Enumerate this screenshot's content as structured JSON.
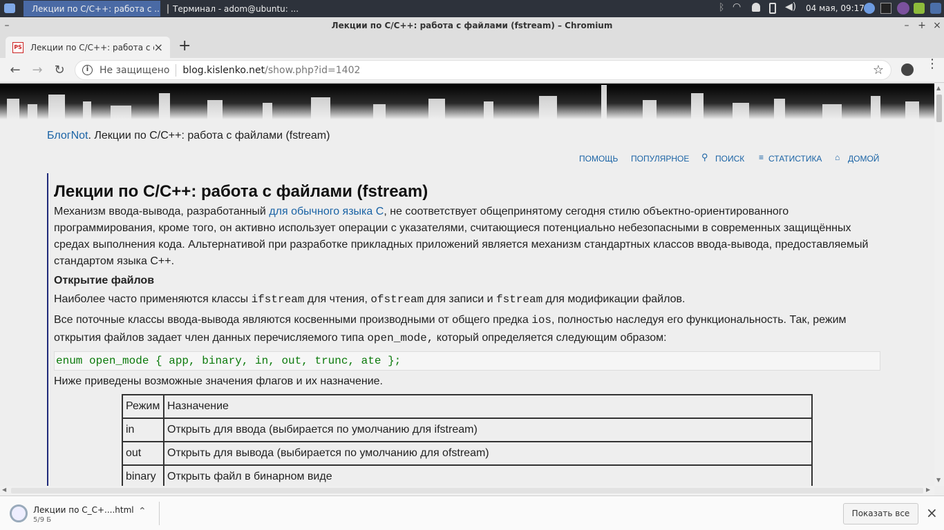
{
  "taskbar": {
    "tasks": [
      {
        "label": "Лекции по C/C++: работа с ..."
      },
      {
        "label": "Терминал - adom@ubuntu: ..."
      }
    ],
    "clock": "04 мая, 09:17"
  },
  "window": {
    "title": "Лекции по C/C++: работа с файлами (fstream) – Chromium"
  },
  "tab": {
    "title": "Лекции по C/C++: работа с фа",
    "favicon_text": "PS"
  },
  "omnibox": {
    "security": "Не защищено",
    "domain": "blog.kislenko.net",
    "path": "/show.php?id=1402"
  },
  "page": {
    "breadcrumb": {
      "link": "БлогNot",
      "rest": ". Лекции по C/C++: работа с файлами (fstream)"
    },
    "nav": {
      "help": "ПОМОЩЬ",
      "popular": "ПОПУЛЯРНОЕ",
      "search": "ПОИСК",
      "stats": "СТАТИСТИКА",
      "home": "ДОМОЙ"
    },
    "article": {
      "title": "Лекции по C/C++: работа с файлами (fstream)",
      "p1_a": "Механизм ввода-вывода, разработанный ",
      "p1_link": "для обычного языка С",
      "p1_b": ", не соответствует общепринятому сегодня стилю объектно-ориентированного программирования, кроме того, он активно использует операции с указателями, считающиеся потенциально небезопасными в современных защищённых средах выполнения кода. Альтернативой при разработке прикладных приложений является механизм стандартных классов ввода-вывода, предоставляемый стандартом языка C++.",
      "h_open": "Открытие файлов",
      "p2_a": "Наиболее часто применяются классы ",
      "p2_c1": "ifstream",
      "p2_b": " для чтения, ",
      "p2_c2": "ofstream",
      "p2_c": " для записи и ",
      "p2_c3": "fstream",
      "p2_d": " для модификации файлов.",
      "p3_a": "Все поточные классы ввода-вывода являются косвенными производными от общего предка ",
      "p3_c1": "ios",
      "p3_b": ", полностью наследуя его функциональность. Так, режим открытия файлов задает член данных перечисляемого типа ",
      "p3_c2": "open_mode,",
      "p3_c": " который определяется следующим образом:",
      "code": "enum open_mode { app, binary, in, out, trunc, ate };",
      "p4": "Ниже приведены возможные значения флагов и их назначение.",
      "table": {
        "headers": [
          "Режим",
          "Назначение"
        ],
        "rows": [
          [
            "in",
            "Открыть для ввода (выбирается по умолчанию для ifstream)"
          ],
          [
            "out",
            "Открыть для вывода (выбирается по умолчанию для ofstream)"
          ],
          [
            "binary",
            "Открыть файл в бинарном виде"
          ]
        ]
      }
    }
  },
  "downloads": {
    "file": "Лекции по C_C+....html",
    "size": "5/9 Б",
    "show_all": "Показать все"
  }
}
